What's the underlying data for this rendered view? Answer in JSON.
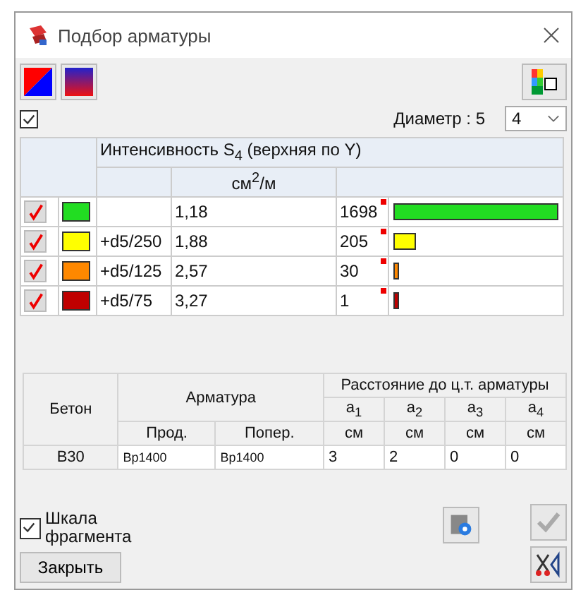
{
  "window": {
    "title": "Подбор арматуры"
  },
  "show_all": {
    "checked": true
  },
  "diameter": {
    "label": "Диаметр : 5",
    "value": "4"
  },
  "intensity_table": {
    "title": "Интенсивность S$_{4}$ (верхняя по Y)",
    "unit": "см$^{2}$/м",
    "rows": [
      {
        "checked": true,
        "color": "#22dd22",
        "label": "",
        "value": "1,18",
        "count": "1698",
        "level": 1
      },
      {
        "checked": true,
        "color": "#ffff00",
        "label": "+d5/250",
        "value": "1,88",
        "count": "205",
        "level": 0.14
      },
      {
        "checked": true,
        "color": "#ff8800",
        "label": "+d5/125",
        "value": "2,57",
        "count": "30",
        "level": 0.03
      },
      {
        "checked": true,
        "color": "#c00000",
        "label": "+d5/75",
        "value": "3,27",
        "count": "1",
        "level": 0.02
      }
    ]
  },
  "params_table": {
    "concrete": "Бетон",
    "rebar": "Арматура",
    "distance": "Расстояние до ц.т. арматуры",
    "a_headers": [
      "a$_{1}$",
      "a$_{2}$",
      "a$_{3}$",
      "a$_{4}$"
    ],
    "long": "Прод.",
    "trans": "Попер.",
    "units": [
      "см",
      "см",
      "см",
      "см"
    ],
    "row": {
      "concrete": "B30",
      "long": "Bp1400",
      "trans": "Bp1400",
      "a": [
        "3",
        "2",
        "0",
        "0"
      ]
    }
  },
  "scale": {
    "label": "Шкала фрагмента",
    "checked": true
  },
  "ok_disabled": true,
  "close_button": "Закрыть"
}
